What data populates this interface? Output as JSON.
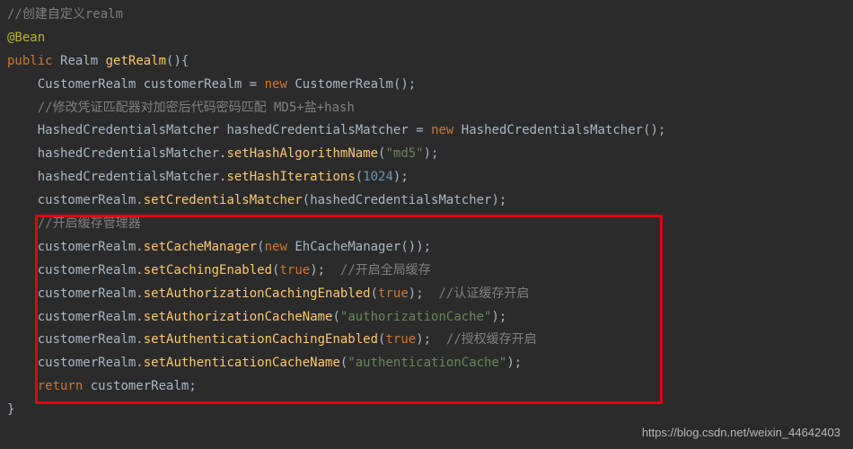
{
  "code": {
    "l1": "//创建自定义realm",
    "l2": "@Bean",
    "l3_kw": "public",
    "l3_type": "Realm",
    "l3_name": "getRealm",
    "l4_type": "CustomerRealm",
    "l4_var": "customerRealm",
    "l4_new": "new",
    "l4_ctor": "CustomerRealm",
    "l5": "//修改凭证匹配器对加密后代码密码匹配 MD5+盐+hash",
    "l6_type": "HashedCredentialsMatcher",
    "l6_var": "hashedCredentialsMatcher",
    "l6_new": "new",
    "l6_ctor": "HashedCredentialsMatcher",
    "l7_obj": "hashedCredentialsMatcher",
    "l7_m": "setHashAlgorithmName",
    "l7_arg": "\"md5\"",
    "l8_obj": "hashedCredentialsMatcher",
    "l8_m": "setHashIterations",
    "l8_arg": "1024",
    "l9_obj": "customerRealm",
    "l9_m": "setCredentialsMatcher",
    "l9_arg": "hashedCredentialsMatcher",
    "l10": "//开启缓存管理器",
    "l11_obj": "customerRealm",
    "l11_m": "setCacheManager",
    "l11_new": "new",
    "l11_ctor": "EhCacheManager",
    "l12_obj": "customerRealm",
    "l12_m": "setCachingEnabled",
    "l12_arg": "true",
    "l12_c": "//开启全局缓存",
    "l13_obj": "customerRealm",
    "l13_m": "setAuthorizationCachingEnabled",
    "l13_arg": "true",
    "l13_c": "//认证缓存开启",
    "l14_obj": "customerRealm",
    "l14_m": "setAuthorizationCacheName",
    "l14_arg": "\"authorizationCache\"",
    "l15_obj": "customerRealm",
    "l15_m": "setAuthenticationCachingEnabled",
    "l15_arg": "true",
    "l15_c": "//授权缓存开启",
    "l16_obj": "customerRealm",
    "l16_m": "setAuthenticationCacheName",
    "l16_arg": "\"authenticationCache\"",
    "l17_kw": "return",
    "l17_var": "customerRealm"
  },
  "watermark": "https://blog.csdn.net/weixin_44642403"
}
